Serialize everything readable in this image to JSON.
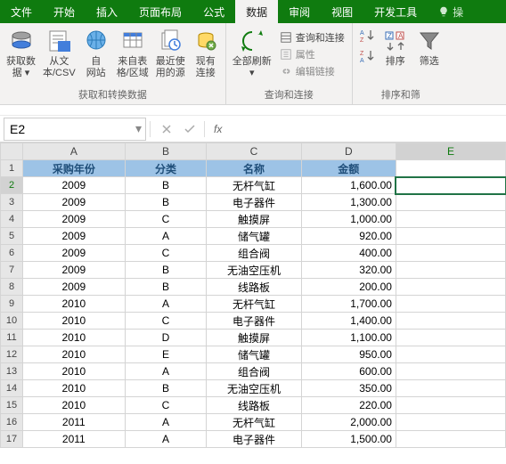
{
  "tabs": {
    "file": "文件",
    "home": "开始",
    "insert": "插入",
    "layout": "页面布局",
    "formula": "公式",
    "data": "数据",
    "review": "审阅",
    "view": "视图",
    "dev": "开发工具",
    "tell": "操"
  },
  "ribbon": {
    "get_data": "获取数\n据 ▾",
    "from_csv": "从文\n本/CSV",
    "from_web": "自\n网站",
    "from_table": "来自表\n格/区域",
    "recent": "最近使\n用的源",
    "existing": "现有\n连接",
    "group1": "获取和转换数据",
    "refresh": "全部刷新\n▾",
    "queries": "查询和连接",
    "properties": "属性",
    "editlinks": "编辑链接",
    "group2": "查询和连接",
    "sort_az": "A→Z",
    "sort_za": "Z→A",
    "sort": "排序",
    "filter": "筛选",
    "group3": "排序和筛"
  },
  "namebox": "E2",
  "fx": "fx",
  "columns": [
    "A",
    "B",
    "C",
    "D",
    "E"
  ],
  "headers": {
    "A": "采购年份",
    "B": "分类",
    "C": "名称",
    "D": "金额"
  },
  "rows": [
    {
      "A": "2009",
      "B": "B",
      "C": "无杆气缸",
      "D": "1,600.00"
    },
    {
      "A": "2009",
      "B": "B",
      "C": "电子器件",
      "D": "1,300.00"
    },
    {
      "A": "2009",
      "B": "C",
      "C": "触摸屏",
      "D": "1,000.00"
    },
    {
      "A": "2009",
      "B": "A",
      "C": "储气罐",
      "D": "920.00"
    },
    {
      "A": "2009",
      "B": "C",
      "C": "组合阀",
      "D": "400.00"
    },
    {
      "A": "2009",
      "B": "B",
      "C": "无油空压机",
      "D": "320.00"
    },
    {
      "A": "2009",
      "B": "B",
      "C": "线路板",
      "D": "200.00"
    },
    {
      "A": "2010",
      "B": "A",
      "C": "无杆气缸",
      "D": "1,700.00"
    },
    {
      "A": "2010",
      "B": "C",
      "C": "电子器件",
      "D": "1,400.00"
    },
    {
      "A": "2010",
      "B": "D",
      "C": "触摸屏",
      "D": "1,100.00"
    },
    {
      "A": "2010",
      "B": "E",
      "C": "储气罐",
      "D": "950.00"
    },
    {
      "A": "2010",
      "B": "A",
      "C": "组合阀",
      "D": "600.00"
    },
    {
      "A": "2010",
      "B": "B",
      "C": "无油空压机",
      "D": "350.00"
    },
    {
      "A": "2010",
      "B": "C",
      "C": "线路板",
      "D": "220.00"
    },
    {
      "A": "2011",
      "B": "A",
      "C": "无杆气缸",
      "D": "2,000.00"
    },
    {
      "A": "2011",
      "B": "A",
      "C": "电子器件",
      "D": "1,500.00"
    }
  ]
}
